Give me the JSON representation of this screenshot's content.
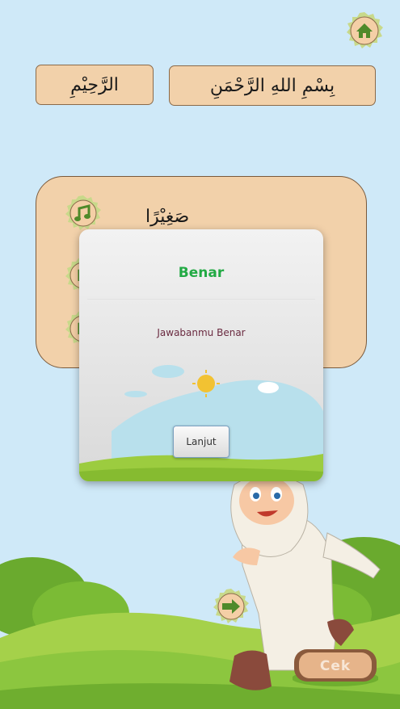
{
  "question": {
    "answer_left": "الرَّحِيْمِ",
    "answer_right": "بِسْمِ اللهِ الرَّحْمَنِ"
  },
  "panel": {
    "row1_text": "صَغِيْرًا"
  },
  "dialog": {
    "title": "Benar",
    "message": "Jawabanmu Benar",
    "button_label": "Lanjut"
  },
  "footer": {
    "check_label": "Cek"
  },
  "icons": {
    "home": "home-icon",
    "audio": "music-note-icon",
    "next": "arrow-right-icon"
  },
  "colors": {
    "sky": "#cfe9f8",
    "box_fill": "#f2d1aa",
    "badge_fill": "#f4cfa6",
    "success_title": "#22aa44",
    "grass": "#8cc63f",
    "badge_icon": "#4f8a2a"
  }
}
